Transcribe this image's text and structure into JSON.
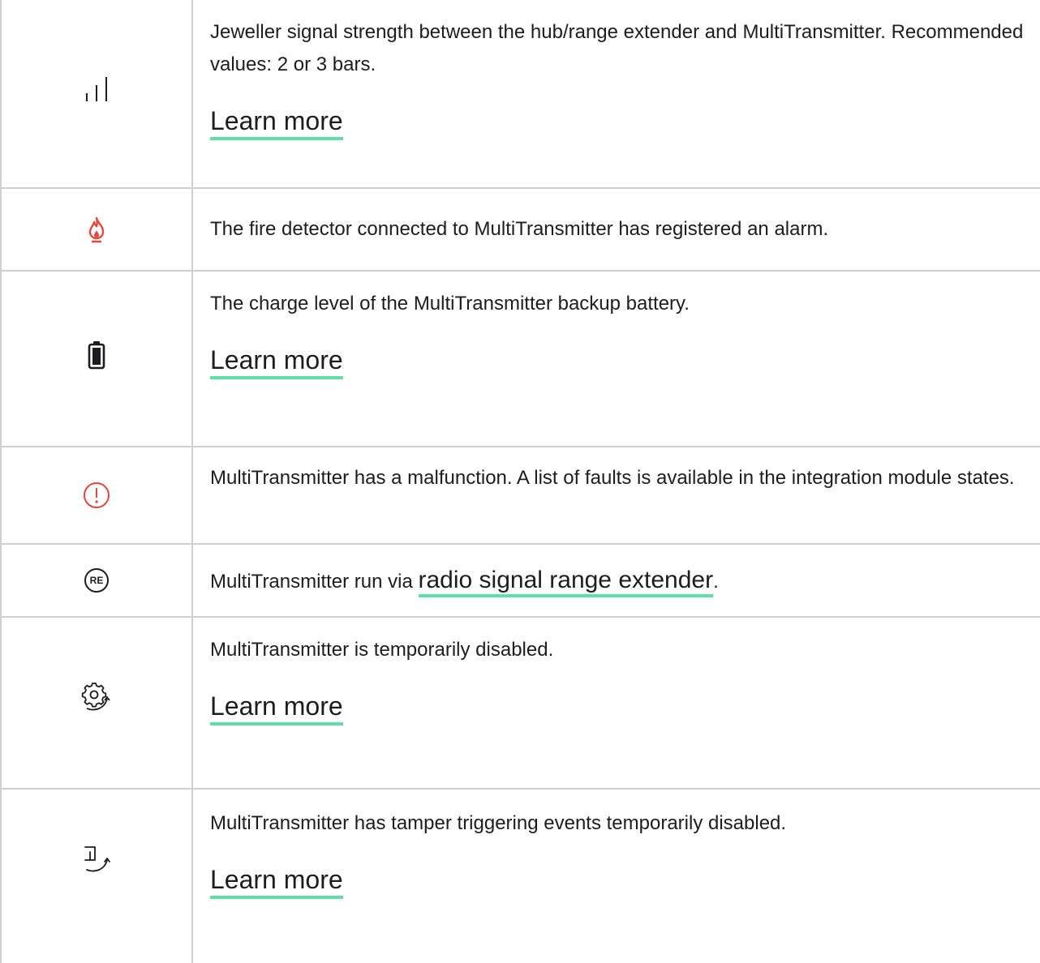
{
  "rows": [
    {
      "icon": "signal-bars-icon",
      "text": "Jeweller signal strength between the hub/range extender and MultiTransmitter. Recommended values: 2 or 3 bars.",
      "link": "Learn more"
    },
    {
      "icon": "fire-icon",
      "text": "The fire detector connected to MultiTransmitter has registered an alarm."
    },
    {
      "icon": "battery-icon",
      "text": "The charge level of the MultiTransmitter backup battery.",
      "link": "Learn more"
    },
    {
      "icon": "exclamation-circle-icon",
      "text": "MultiTransmitter has a malfunction. A list of faults is available in the integration module states."
    },
    {
      "icon": "range-extender-icon",
      "icon_label": "RE",
      "text_before": "MultiTransmitter run via ",
      "link": "radio signal range extender",
      "text_after": "."
    },
    {
      "icon": "gear-disabled-icon",
      "text": "MultiTransmitter is temporarily disabled.",
      "link": "Learn more"
    },
    {
      "icon": "tamper-disabled-icon",
      "text": "MultiTransmitter has tamper triggering events temporarily disabled.",
      "link": "Learn more"
    }
  ],
  "colors": {
    "border": "#d0d0d0",
    "link_underline": "#5fe0a8",
    "alert_red": "#e5483b",
    "text": "#1d1d1f"
  }
}
